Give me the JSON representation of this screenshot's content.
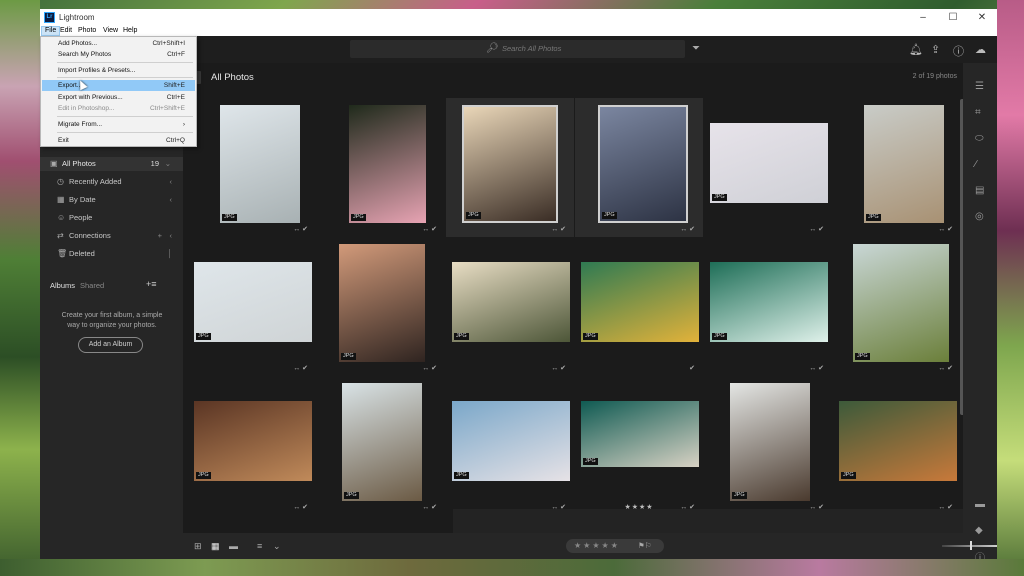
{
  "window": {
    "title": "Lightroom",
    "app_icon": "Lr",
    "minimize": "–",
    "maximize": "☐",
    "close": "✕"
  },
  "menubar": {
    "file": "File",
    "edit": "Edit",
    "photo": "Photo",
    "view": "View",
    "help": "Help"
  },
  "file_menu": {
    "items": [
      {
        "label": "Add Photos...",
        "shortcut": "Ctrl+Shift+I"
      },
      {
        "label": "Search My Photos",
        "shortcut": "Ctrl+F"
      },
      {
        "label": "Import Profiles & Presets..."
      },
      {
        "label": "Export...",
        "shortcut": "Shift+E"
      },
      {
        "label": "Export with Previous...",
        "shortcut": "Ctrl+E"
      },
      {
        "label": "Edit in Photoshop...",
        "shortcut": "Ctrl+Shift+E"
      },
      {
        "label": "Migrate From...",
        "shortcut": "›"
      },
      {
        "label": "Exit",
        "shortcut": "Ctrl+Q"
      }
    ]
  },
  "search": {
    "placeholder": "Search All Photos"
  },
  "sidebar": {
    "all_photos": {
      "label": "All Photos",
      "count": "19"
    },
    "items": [
      {
        "label": "Recently Added",
        "icon": "clock-icon"
      },
      {
        "label": "By Date",
        "icon": "calendar-icon"
      },
      {
        "label": "People",
        "icon": "person-icon"
      },
      {
        "label": "Connections",
        "icon": "connections-icon"
      },
      {
        "label": "Deleted",
        "icon": "trash-icon"
      }
    ],
    "albums_tab": "Albums",
    "shared_tab": "Shared",
    "albums_message": "Create your first album, a simple way to organize your photos.",
    "add_album_button": "Add an Album"
  },
  "content": {
    "title": "All Photos",
    "count": "2 of 19 photos"
  },
  "photos": [
    {
      "badge": "JPG",
      "selected": false,
      "colors": [
        "#dfe6ea",
        "#a8b1b3"
      ]
    },
    {
      "badge": "JPG",
      "selected": false,
      "colors": [
        "#1f2a1b",
        "#e7a3b3"
      ]
    },
    {
      "badge": "JPG",
      "selected": true,
      "colors": [
        "#e9d6b8",
        "#3a2d25"
      ]
    },
    {
      "badge": "JPG",
      "selected": true,
      "colors": [
        "#7b86a0",
        "#2d3344"
      ]
    },
    {
      "badge": "JPG",
      "selected": false,
      "colors": [
        "#e7e3ea",
        "#cfd0d6"
      ]
    },
    {
      "badge": "JPG",
      "selected": false,
      "colors": [
        "#c9ccc8",
        "#a89173"
      ]
    },
    {
      "badge": "JPG",
      "selected": false,
      "colors": [
        "#dfe6ea",
        "#cfd4d6"
      ]
    },
    {
      "badge": "JPG",
      "selected": false,
      "colors": [
        "#d29a7a",
        "#2f2420"
      ]
    },
    {
      "badge": "JPG",
      "selected": false,
      "colors": [
        "#e8ddc4",
        "#4d5638"
      ]
    },
    {
      "badge": "JPG",
      "selected": false,
      "colors": [
        "#2f7a52",
        "#e2b23a"
      ]
    },
    {
      "badge": "JPG",
      "selected": false,
      "colors": [
        "#1e6e57",
        "#dff1ea"
      ]
    },
    {
      "badge": "JPG",
      "selected": false,
      "colors": [
        "#c9d7d6",
        "#6b7f3a"
      ]
    },
    {
      "badge": "JPG",
      "selected": false,
      "colors": [
        "#5a3524",
        "#c08a5a"
      ]
    },
    {
      "badge": "JPG",
      "selected": false,
      "colors": [
        "#d9e3e6",
        "#6b5a44"
      ]
    },
    {
      "badge": "JPG",
      "selected": false,
      "colors": [
        "#7aa7c9",
        "#e6e2e6"
      ]
    },
    {
      "badge": "JPG",
      "selected": false,
      "colors": [
        "#0f5a52",
        "#d8d2c4"
      ]
    },
    {
      "badge": "JPG",
      "selected": false,
      "colors": [
        "#e4e6e4",
        "#4a3a2e"
      ]
    },
    {
      "badge": "JPG",
      "selected": false,
      "colors": [
        "#3c5a3a",
        "#c8793a"
      ]
    }
  ],
  "row2_stars": "★★★★",
  "bottombar": {
    "rating_stars": "★★★★★"
  }
}
